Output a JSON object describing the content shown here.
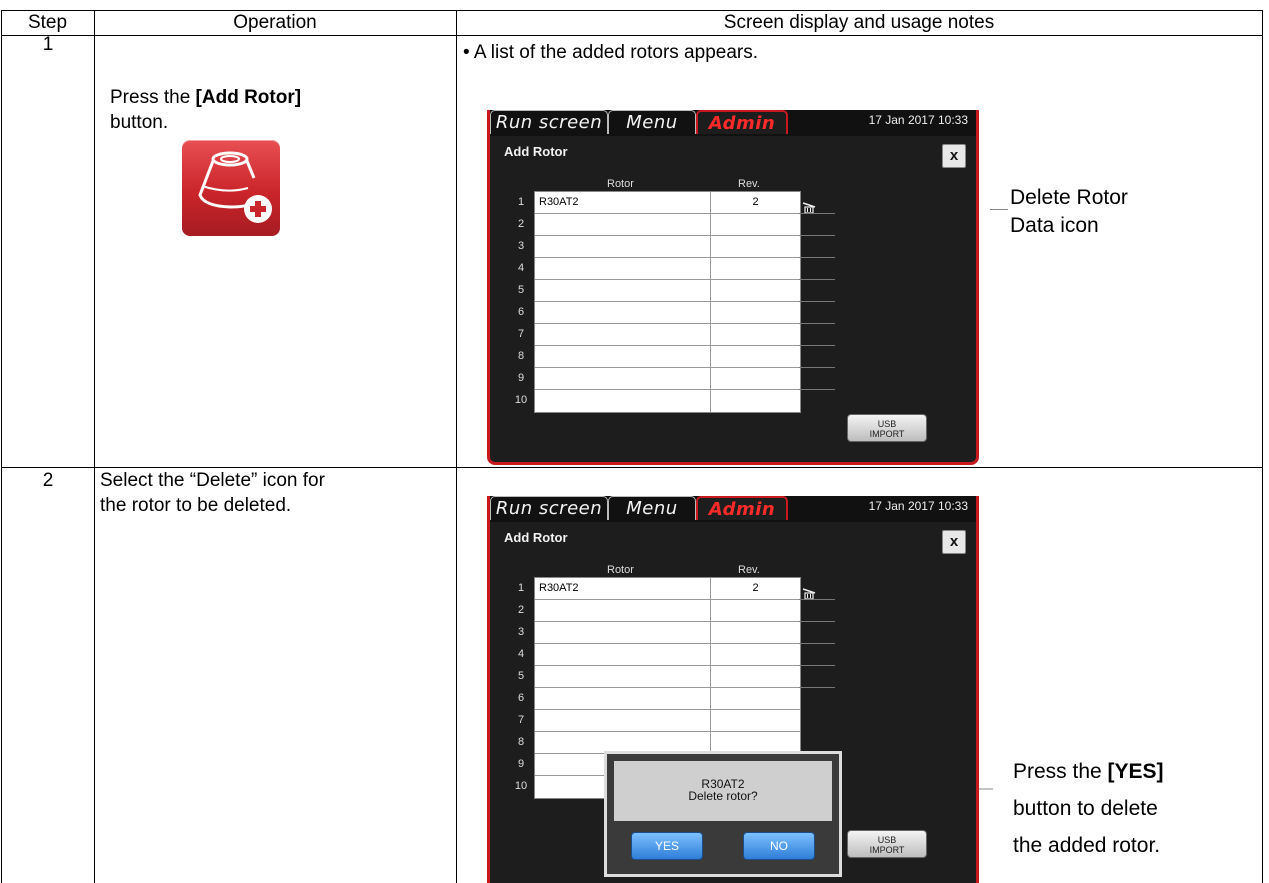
{
  "header": {
    "step": "Step",
    "operation": "Operation",
    "notes": "Screen display and usage notes"
  },
  "steps": [
    {
      "number": "1",
      "operation_prefix": "Press the ",
      "operation_bold": "[Add Rotor]",
      "operation_suffix": "button.",
      "note": "• A list of the added rotors appears.",
      "callout_line1": "Delete Rotor",
      "callout_line2": "Data icon"
    },
    {
      "number": "2",
      "operation_line1": "Select the “Delete” icon for",
      "operation_line2": "the rotor to be deleted.",
      "callout_prefix": "Press the ",
      "callout_bold": "[YES]",
      "callout_line2": "button to delete",
      "callout_line3": "the added rotor."
    }
  ],
  "screen": {
    "tabs": [
      "Run screen",
      "Menu",
      "Admin"
    ],
    "datetime": "17  Jan  2017  10:33",
    "title": "Add Rotor",
    "close": "x",
    "col_rotor": "Rotor",
    "col_rev": "Rev.",
    "rows": [
      {
        "num": "1",
        "rotor": "R30AT2",
        "rev": "2"
      },
      {
        "num": "2",
        "rotor": "",
        "rev": ""
      },
      {
        "num": "3",
        "rotor": "",
        "rev": ""
      },
      {
        "num": "4",
        "rotor": "",
        "rev": ""
      },
      {
        "num": "5",
        "rotor": "",
        "rev": ""
      },
      {
        "num": "6",
        "rotor": "",
        "rev": ""
      },
      {
        "num": "7",
        "rotor": "",
        "rev": ""
      },
      {
        "num": "8",
        "rotor": "",
        "rev": ""
      },
      {
        "num": "9",
        "rotor": "",
        "rev": ""
      },
      {
        "num": "10",
        "rotor": "",
        "rev": ""
      }
    ],
    "usb_line1": "USB",
    "usb_line2": "IMPORT"
  },
  "dialog": {
    "line1": "R30AT2",
    "line2": "Delete rotor?",
    "yes": "YES",
    "no": "NO"
  },
  "colors": {
    "accent_red": "#c61a1f",
    "dialog_button": "#2e7dd8"
  }
}
